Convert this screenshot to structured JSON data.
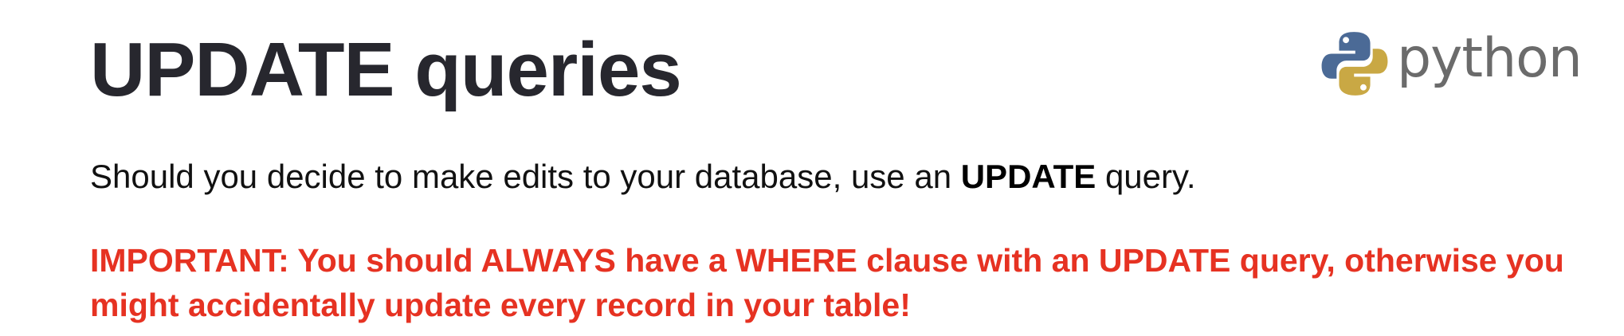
{
  "slide": {
    "title": "UPDATE queries",
    "logo": {
      "icon": "python-logo-icon",
      "wordmark": "python",
      "colors": {
        "blue": "#4b6a96",
        "yellow": "#c9a844",
        "text": "#6b6b6b"
      }
    },
    "body": {
      "text_before": "Should you decide to make edits to your database, use an ",
      "keyword": "UPDATE",
      "text_after": " query."
    },
    "warning": {
      "text": "IMPORTANT: You should ALWAYS have a WHERE clause with an UPDATE query, otherwise you might accidentally update every record in your table!",
      "color": "#e63222"
    }
  }
}
